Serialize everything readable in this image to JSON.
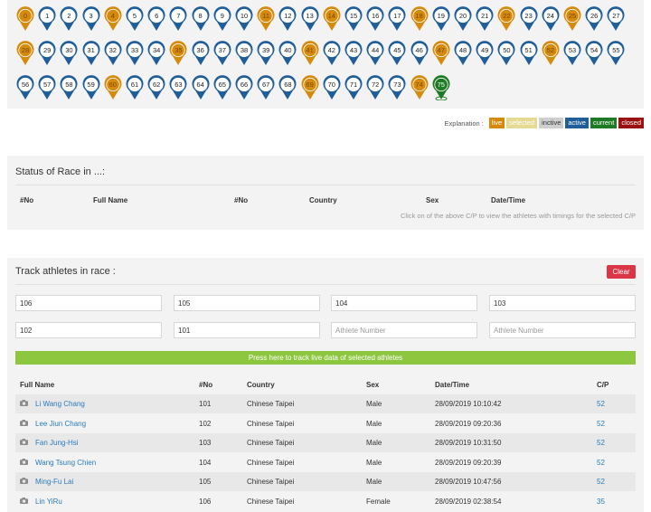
{
  "checkpoints": [
    {
      "n": "0",
      "status": "live"
    },
    {
      "n": "1",
      "status": "active"
    },
    {
      "n": "2",
      "status": "active"
    },
    {
      "n": "3",
      "status": "active"
    },
    {
      "n": "4",
      "status": "live"
    },
    {
      "n": "5",
      "status": "active"
    },
    {
      "n": "6",
      "status": "active"
    },
    {
      "n": "7",
      "status": "active"
    },
    {
      "n": "8",
      "status": "active"
    },
    {
      "n": "9",
      "status": "active"
    },
    {
      "n": "10",
      "status": "active"
    },
    {
      "n": "11",
      "status": "live"
    },
    {
      "n": "12",
      "status": "active"
    },
    {
      "n": "13",
      "status": "active"
    },
    {
      "n": "14",
      "status": "live"
    },
    {
      "n": "15",
      "status": "active"
    },
    {
      "n": "16",
      "status": "active"
    },
    {
      "n": "17",
      "status": "active"
    },
    {
      "n": "18",
      "status": "live"
    },
    {
      "n": "19",
      "status": "active"
    },
    {
      "n": "20",
      "status": "active"
    },
    {
      "n": "21",
      "status": "active"
    },
    {
      "n": "22",
      "status": "live"
    },
    {
      "n": "23",
      "status": "active"
    },
    {
      "n": "24",
      "status": "active"
    },
    {
      "n": "25",
      "status": "live"
    },
    {
      "n": "26",
      "status": "active"
    },
    {
      "n": "27",
      "status": "active"
    },
    {
      "n": "28",
      "status": "live"
    },
    {
      "n": "29",
      "status": "active"
    },
    {
      "n": "30",
      "status": "active"
    },
    {
      "n": "31",
      "status": "active"
    },
    {
      "n": "32",
      "status": "active"
    },
    {
      "n": "33",
      "status": "active"
    },
    {
      "n": "34",
      "status": "active"
    },
    {
      "n": "35",
      "status": "live"
    },
    {
      "n": "36",
      "status": "active"
    },
    {
      "n": "37",
      "status": "active"
    },
    {
      "n": "38",
      "status": "active"
    },
    {
      "n": "39",
      "status": "active"
    },
    {
      "n": "40",
      "status": "active"
    },
    {
      "n": "41",
      "status": "live"
    },
    {
      "n": "42",
      "status": "active"
    },
    {
      "n": "43",
      "status": "active"
    },
    {
      "n": "44",
      "status": "active"
    },
    {
      "n": "45",
      "status": "active"
    },
    {
      "n": "46",
      "status": "active"
    },
    {
      "n": "47",
      "status": "live"
    },
    {
      "n": "48",
      "status": "active"
    },
    {
      "n": "49",
      "status": "active"
    },
    {
      "n": "50",
      "status": "active"
    },
    {
      "n": "51",
      "status": "active"
    },
    {
      "n": "52",
      "status": "live"
    },
    {
      "n": "53",
      "status": "active"
    },
    {
      "n": "54",
      "status": "active"
    },
    {
      "n": "55",
      "status": "active"
    },
    {
      "n": "56",
      "status": "active"
    },
    {
      "n": "57",
      "status": "active"
    },
    {
      "n": "58",
      "status": "active"
    },
    {
      "n": "59",
      "status": "active"
    },
    {
      "n": "60",
      "status": "live"
    },
    {
      "n": "61",
      "status": "active"
    },
    {
      "n": "62",
      "status": "active"
    },
    {
      "n": "63",
      "status": "active"
    },
    {
      "n": "64",
      "status": "active"
    },
    {
      "n": "65",
      "status": "active"
    },
    {
      "n": "66",
      "status": "active"
    },
    {
      "n": "67",
      "status": "active"
    },
    {
      "n": "68",
      "status": "active"
    },
    {
      "n": "69",
      "status": "live"
    },
    {
      "n": "70",
      "status": "active"
    },
    {
      "n": "71",
      "status": "active"
    },
    {
      "n": "72",
      "status": "active"
    },
    {
      "n": "73",
      "status": "active"
    },
    {
      "n": "74",
      "status": "live"
    },
    {
      "n": "75",
      "status": "current"
    }
  ],
  "status_colors": {
    "live": "#d58a0b",
    "active": "#1f5e99",
    "current": "#1e7a24",
    "pin_face": "#ffffff",
    "selected": "#e6d992",
    "inctive": "#cfcfcf",
    "closed": "#9a1111"
  },
  "explanation": {
    "label": "Explanation :",
    "tags": {
      "live": "live",
      "selected": "selected",
      "inctive": "inctive",
      "active": "active",
      "current": "current",
      "closed": "closed"
    }
  },
  "status_panel": {
    "title": "Status of Race in ...:",
    "headers": {
      "no": "#No",
      "full_name": "Full Name",
      "no2": "#No",
      "country": "Country",
      "sex": "Sex",
      "datetime": "Date/Time"
    },
    "hint": "Click on of the above C/P to view the athletes with timings for the selected C/P"
  },
  "track_panel": {
    "title": "Track athletes in race :",
    "clear_label": "Clear",
    "inputs": [
      {
        "value": "106",
        "placeholder": "Athlete Number"
      },
      {
        "value": "105",
        "placeholder": "Athlete Number"
      },
      {
        "value": "104",
        "placeholder": "Athlete Number"
      },
      {
        "value": "103",
        "placeholder": "Athlete Number"
      },
      {
        "value": "102",
        "placeholder": "Athlete Number"
      },
      {
        "value": "101",
        "placeholder": "Athlete Number"
      },
      {
        "value": "",
        "placeholder": "Athlete Number"
      },
      {
        "value": "",
        "placeholder": "Athlete Number"
      }
    ],
    "track_button": "Press here to track live data of selected athletes",
    "headers": {
      "full_name": "Full Name",
      "no": "#No",
      "country": "Country",
      "sex": "Sex",
      "datetime": "Date/Time",
      "cp": "C/P"
    },
    "rows": [
      {
        "name": "Li Wang Chang",
        "no": "101",
        "country": "Chinese Taipei",
        "sex": "Male",
        "datetime": "28/09/2019 10:10:42",
        "cp": "52"
      },
      {
        "name": "Lee Jiun Chang",
        "no": "102",
        "country": "Chinese Taipei",
        "sex": "Male",
        "datetime": "28/09/2019 09:20:36",
        "cp": "52"
      },
      {
        "name": "Fan Jung-Hsi",
        "no": "103",
        "country": "Chinese Taipei",
        "sex": "Male",
        "datetime": "28/09/2019 10:31:50",
        "cp": "52"
      },
      {
        "name": "Wang Tsung Chien",
        "no": "104",
        "country": "Chinese Taipei",
        "sex": "Male",
        "datetime": "28/09/2019 09:20:39",
        "cp": "52"
      },
      {
        "name": "Ming-Fu Lai",
        "no": "105",
        "country": "Chinese Taipei",
        "sex": "Male",
        "datetime": "28/09/2019 10:47:56",
        "cp": "52"
      },
      {
        "name": "Lin YiRu",
        "no": "106",
        "country": "Chinese Taipei",
        "sex": "Female",
        "datetime": "28/09/2019 02:38:54",
        "cp": "35"
      }
    ]
  }
}
